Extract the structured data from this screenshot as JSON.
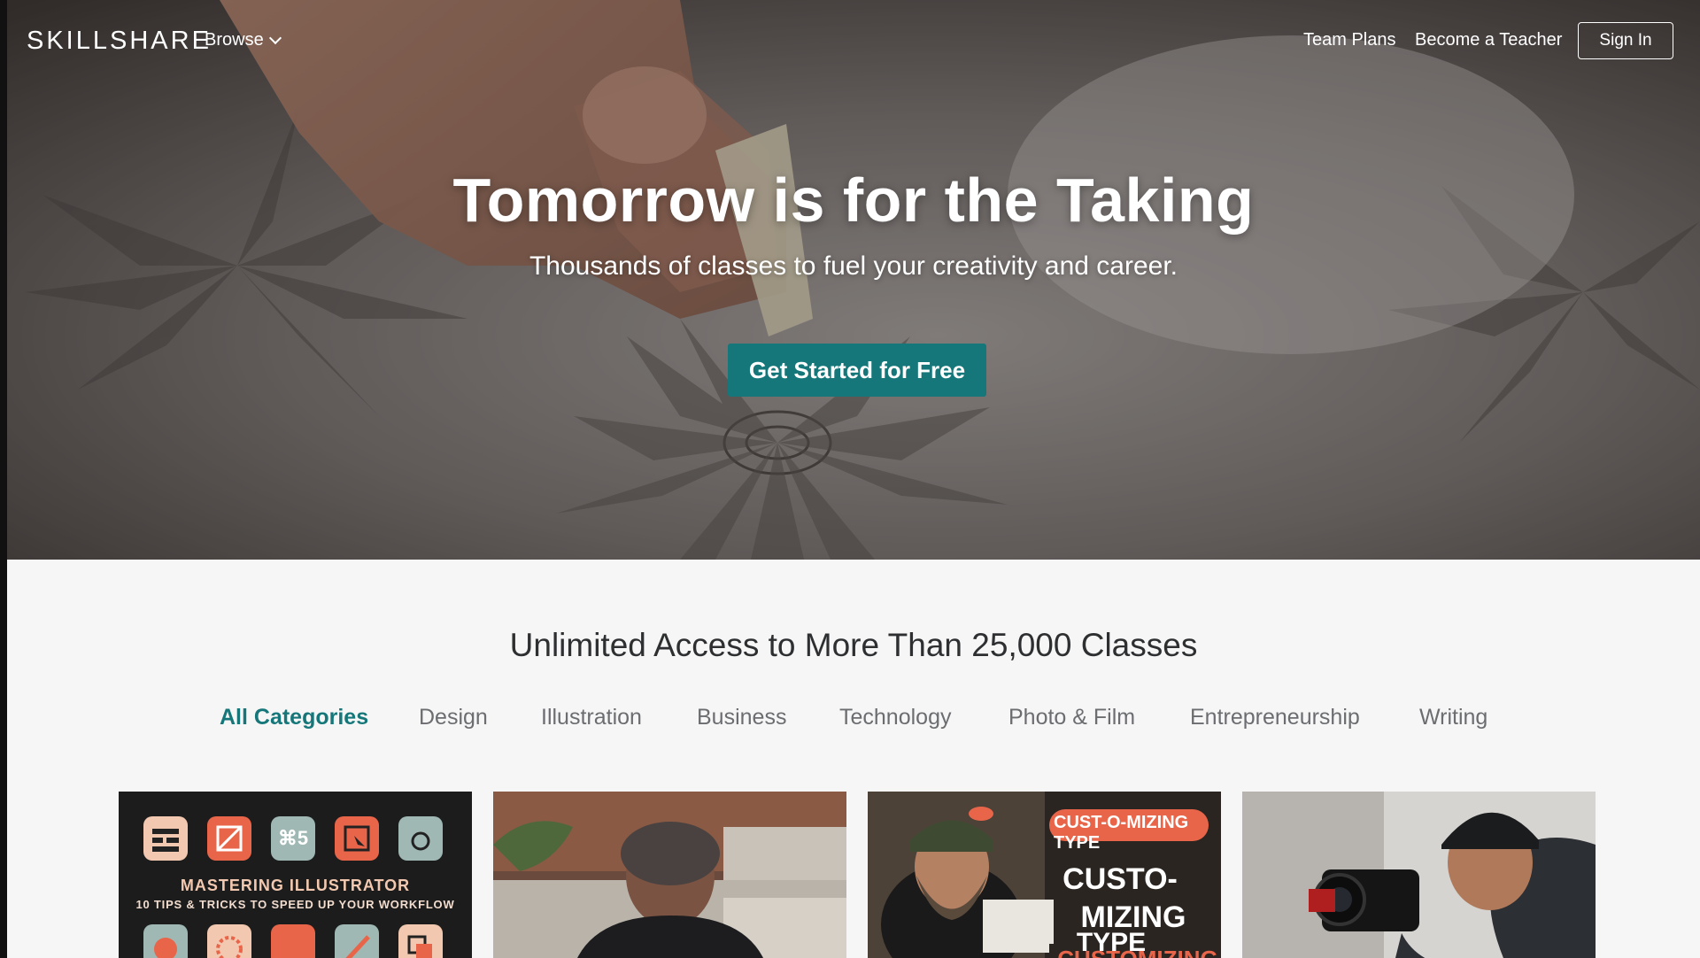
{
  "nav": {
    "logo": "SKILLSHARE",
    "browse_label": "Browse",
    "team_plans": "Team Plans",
    "become_teacher": "Become a Teacher",
    "sign_in": "Sign In"
  },
  "hero": {
    "title": "Tomorrow is for the Taking",
    "subtitle": "Thousands of classes to fuel your creativity and career.",
    "cta_label": "Get Started for Free"
  },
  "catalog": {
    "title": "Unlimited Access to More Than 25,000 Classes",
    "tabs": [
      {
        "label": "All Categories",
        "active": true
      },
      {
        "label": "Design",
        "active": false
      },
      {
        "label": "Illustration",
        "active": false
      },
      {
        "label": "Business",
        "active": false
      },
      {
        "label": "Technology",
        "active": false
      },
      {
        "label": "Photo & Film",
        "active": false
      },
      {
        "label": "Entrepreneurship",
        "active": false
      },
      {
        "label": "Writing",
        "active": false
      }
    ]
  },
  "cards": [
    {
      "title_line1": "MASTERING ILLUSTRATOR",
      "title_line2": "10 TIPS & TRICKS TO SPEED UP YOUR WORKFLOW",
      "icon_glyph": "⌘5"
    },
    {},
    {
      "headline": "CUST-O-MIZING TYPE",
      "stack_lines": [
        "CUSTO-",
        "MIZING",
        "TYPE"
      ],
      "bottom_word": "CUSTOMIZING"
    },
    {}
  ],
  "colors": {
    "accent": "#157779",
    "section_bg": "#f6f6f6",
    "title_text": "#2d2f31",
    "tab_text": "#6b6d70"
  }
}
